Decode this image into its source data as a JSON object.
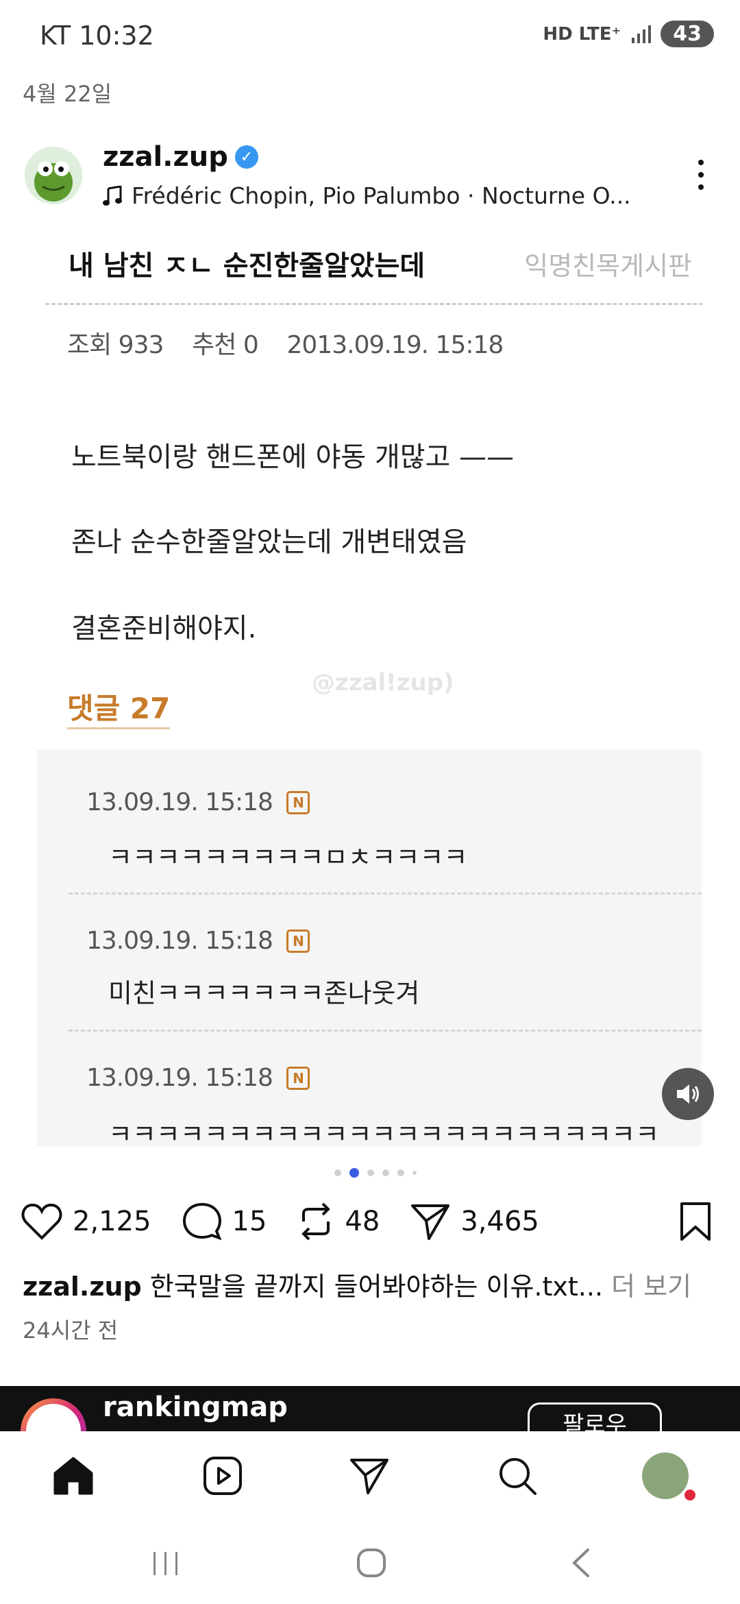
{
  "status_bar": {
    "carrier_time": "KT 10:32",
    "network": "HD LTE⁺",
    "battery": "43"
  },
  "date_label": "4월 22일",
  "post": {
    "username": "zzal.zup",
    "music": "Frédéric Chopin, Pio Palumbo · Nocturne O...",
    "image": {
      "title": "내 남친 ㅈㄴ 순진한줄알았는데",
      "board": "익명친목게시판",
      "meta": "조회 933    추천 0    2013.09.19. 15:18",
      "body_lines": [
        "노트북이랑 핸드폰에 야동 개많고 ——",
        "존나 순수한줄알았는데 개변태였음",
        "결혼준비해야지."
      ],
      "watermark": "@zzal!zup)",
      "comments_label": "댓글 27",
      "comments": [
        {
          "time": "13.09.19. 15:18",
          "badge": "N",
          "text": "ㅋㅋㅋㅋㅋㅋㅋㅋㅋㅁㅊㅋㅋㅋㅋ"
        },
        {
          "time": "13.09.19. 15:18",
          "badge": "N",
          "text": "미친ㅋㅋㅋㅋㅋㅋㅋ존나웃겨"
        },
        {
          "time": "13.09.19. 15:18",
          "badge": "N",
          "text": "ㅋㅋㅋㅋㅋㅋㅋㅋㅋㅋㅋㅋㅋㅋㅋㅋㅋㅋㅋㅋㅋㅋㅋ"
        }
      ]
    },
    "likes": "2,125",
    "comments_count": "15",
    "reposts": "48",
    "shares": "3,465",
    "caption_user": "zzal.zup",
    "caption_text": " 한국말을 끝까지 들어봐야하는 이유.txt...",
    "more_label": " 더 보기",
    "time_ago": "24시간 전"
  },
  "next_post": {
    "username": "rankingmap",
    "follow_label": "팔로우"
  },
  "colors": {
    "accent": "#3b5be0",
    "link_orange": "#c77b2a",
    "verified": "#3897f0",
    "notification": "#e0283d"
  },
  "icons": [
    "home-icon",
    "reels-icon",
    "send-icon",
    "search-icon",
    "profile-icon",
    "heart-icon",
    "comment-icon",
    "repost-icon",
    "share-icon",
    "bookmark-icon",
    "more-icon",
    "sound-icon"
  ]
}
